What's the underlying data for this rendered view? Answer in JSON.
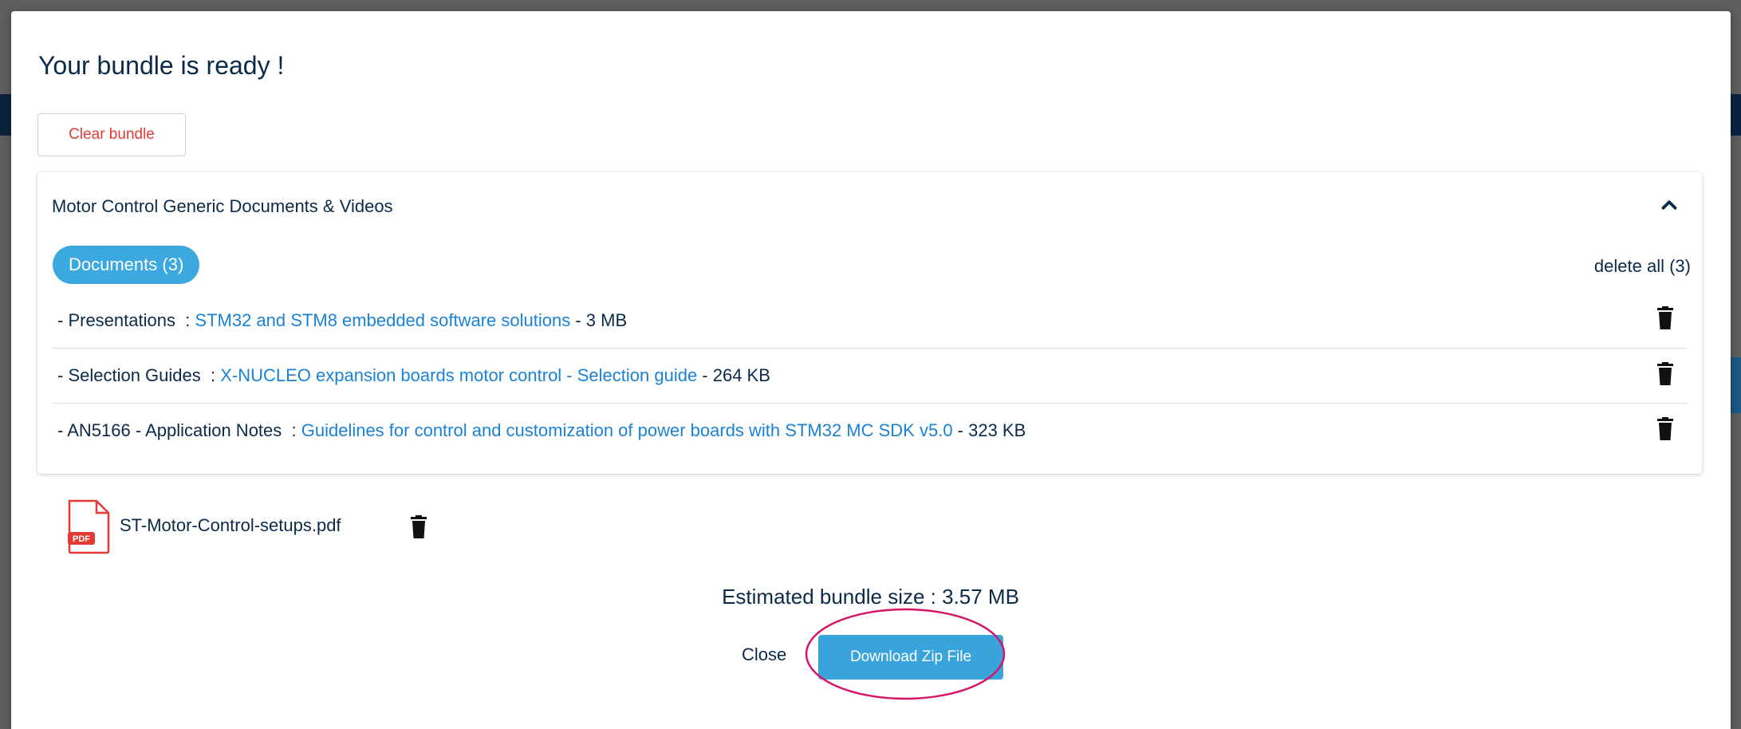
{
  "modal": {
    "title": "Your bundle is ready !",
    "clear_button": "Clear bundle"
  },
  "panel": {
    "title": "Motor Control Generic Documents & Videos",
    "documents_badge": "Documents (3)",
    "delete_all": "delete all (3)",
    "rows": [
      {
        "category": "- Presentations  : ",
        "title": "STM32 and STM8 embedded software solutions",
        "size": " - 3 MB"
      },
      {
        "category": "- Selection Guides  : ",
        "title": "X-NUCLEO expansion boards motor control - Selection guide",
        "size": " - 264 KB"
      },
      {
        "category": "- AN5166 - Application Notes  : ",
        "title": "Guidelines for control and customization of power boards with STM32 MC SDK v5.0",
        "size": " - 323 KB"
      }
    ]
  },
  "attachment": {
    "filename": "ST-Motor-Control-setups.pdf",
    "icon_label": "PDF"
  },
  "footer": {
    "estimate_label": "Estimated bundle size : ",
    "estimate_value": "3.57 MB",
    "close": "Close",
    "download": "Download Zip File"
  },
  "colors": {
    "accent": "#3ba8e0",
    "link": "#1a82d6",
    "danger": "#e53935",
    "text": "#0b2a4a",
    "highlight_ring": "#d6136a"
  },
  "icons": [
    "chevron-up-icon",
    "trash-icon",
    "pdf-file-icon"
  ]
}
